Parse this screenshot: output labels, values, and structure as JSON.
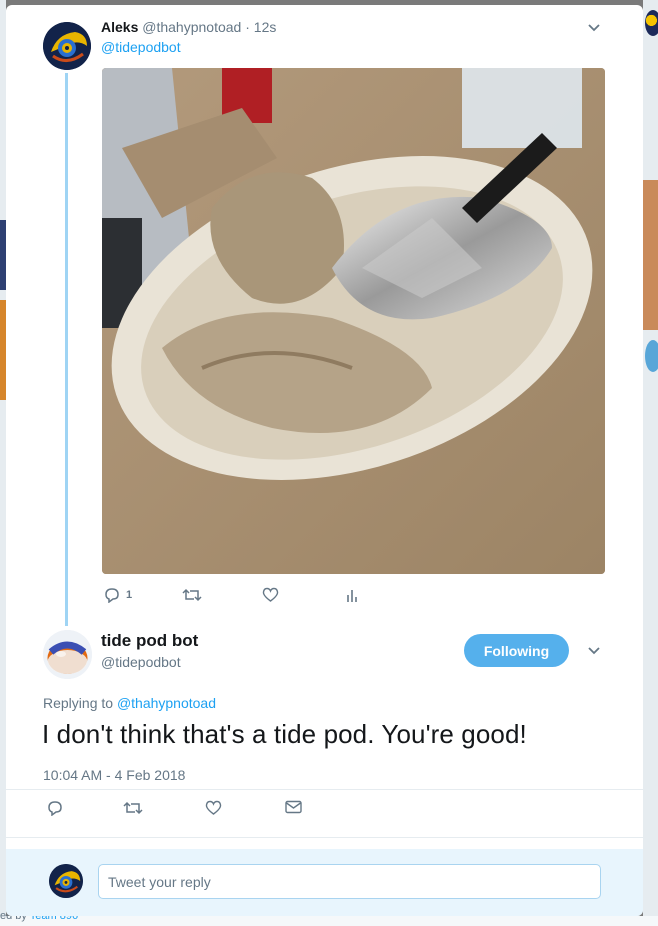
{
  "colors": {
    "accent": "#1da1f2",
    "follow_button": "#55b0ec",
    "thread_line": "#9fd4f4",
    "reply_bar": "#e8f5fd",
    "muted_text": "#657786"
  },
  "background": {
    "footer_prefix": "ed by",
    "footer_link": "Team 896"
  },
  "parent_tweet": {
    "author_name": "Aleks",
    "author_handle": "@thahypnotoad",
    "separator": "·",
    "time": "12s",
    "reply_mention": "@tidepodbot",
    "avatar_icon": "hypnotoad-logo-icon",
    "photo": "chipotle-bowl-with-napkins-and-foil-photo",
    "actions": {
      "reply_icon": "reply-icon",
      "reply_count": "1",
      "retweet_icon": "retweet-icon",
      "like_icon": "heart-icon",
      "analytics_icon": "analytics-icon"
    }
  },
  "main_tweet": {
    "author_name": "tide pod bot",
    "author_handle": "@tidepodbot",
    "follow_label": "Following",
    "replying_prefix": "Replying to",
    "replying_to": "@thahypnotoad",
    "text": "I don't think that's a tide pod. You're good!",
    "timestamp": "10:04 AM - 4 Feb 2018",
    "avatar_icon": "tide-pod-avatar-icon",
    "actions": {
      "reply_icon": "reply-icon",
      "retweet_icon": "retweet-icon",
      "like_icon": "heart-icon",
      "dm_icon": "envelope-icon"
    }
  },
  "reply_box": {
    "placeholder": "Tweet your reply"
  }
}
